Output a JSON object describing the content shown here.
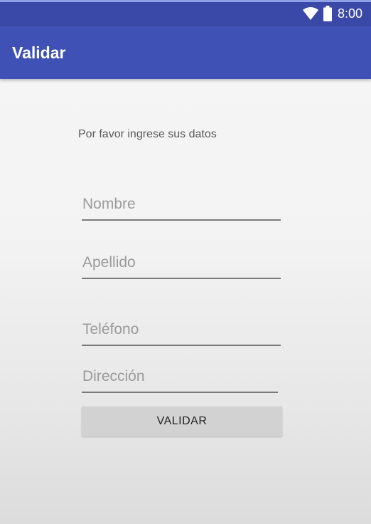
{
  "status_bar": {
    "time": "8:00",
    "icons": [
      "wifi-icon",
      "battery-icon"
    ],
    "color": "#3a49a8"
  },
  "app_bar": {
    "title": "Validar",
    "color": "#3f51b5"
  },
  "form": {
    "prompt": "Por favor ingrese sus datos",
    "fields": [
      {
        "name": "nombre",
        "placeholder": "Nombre",
        "value": ""
      },
      {
        "name": "apellido",
        "placeholder": "Apellido",
        "value": ""
      },
      {
        "name": "telefono",
        "placeholder": "Teléfono",
        "value": ""
      },
      {
        "name": "direccion",
        "placeholder": "Dirección",
        "value": ""
      }
    ],
    "submit_label": "VALIDAR"
  }
}
